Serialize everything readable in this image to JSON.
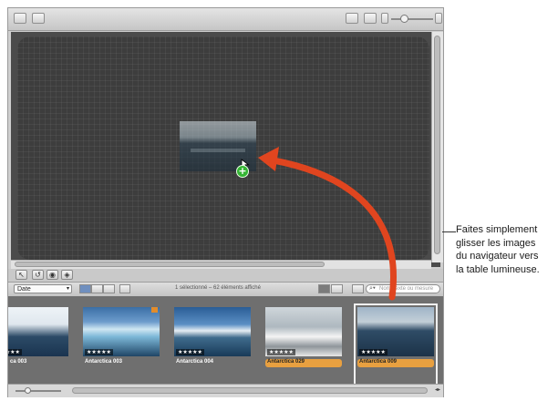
{
  "browser": {
    "sort_label": "Date",
    "status": "1 sélectionné – 62 éléments affiché",
    "search_placeholder": "Nom, texte ou mesure"
  },
  "thumbnails": [
    {
      "caption": "ca 003",
      "stars": "★★★★★",
      "selected": false
    },
    {
      "caption": "Antarctica 003",
      "stars": "★★★★★",
      "selected": false
    },
    {
      "caption": "Antarctica 004",
      "stars": "★★★★★",
      "selected": false
    },
    {
      "caption": "Antarctica 029",
      "stars": "★★★★★",
      "selected": true
    },
    {
      "caption": "Antarctica 009",
      "stars": "★★★★★",
      "selected": true
    }
  ],
  "callout": {
    "line1": "Faites simplement",
    "line2": "glisser les images",
    "line3": "du navigateur vers",
    "line4": "la table lumineuse."
  },
  "colors": {
    "arrow": "#e0451f",
    "selection": "#e8a040",
    "add_badge": "#35b534"
  },
  "icons": [
    "list-view-icon",
    "photo-icon",
    "light-table-icon",
    "zoom-icon",
    "pointer-tool-icon",
    "rotate-tool-icon",
    "stamp-tool-icon",
    "lift-tool-icon",
    "search-icon",
    "add-icon"
  ]
}
